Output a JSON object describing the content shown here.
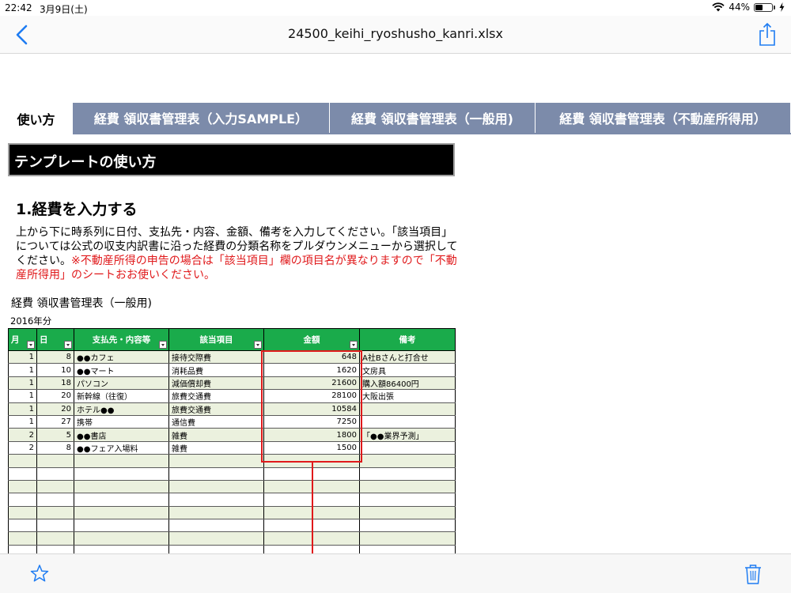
{
  "status": {
    "time": "22:42",
    "date": "3月9日(土)",
    "battery": "44%",
    "battery_level": 0.44
  },
  "nav": {
    "title": "24500_keihi_ryoshusho_kanri.xlsx"
  },
  "tabs": [
    {
      "label": "使い方",
      "active": true
    },
    {
      "label": "経費 領収書管理表（入力SAMPLE）",
      "active": false
    },
    {
      "label": "経費 領収書管理表（一般用)",
      "active": false
    },
    {
      "label": "経費 領収書管理表（不動産所得用）",
      "active": false
    }
  ],
  "content": {
    "banner": "テンプレートの使い方",
    "section_title": "1.経費を入力する",
    "para_black": "上から下に時系列に日付、支払先・内容、金額、備考を入力してください。「該当項目」については公式の収支内訳書に沿った経費の分類名称をプルダウンメニューから選択してください。",
    "para_red": "※不動産所得の申告の場合は「該当項目」欄の項目名が異なりますので「不動産所得用」のシートおお使いください。",
    "sheet_title": "経費 領収書管理表（一般用)",
    "year": "2016年分"
  },
  "table": {
    "headers": [
      "月",
      "日",
      "支払先・内容等",
      "該当項目",
      "金額",
      "備考"
    ],
    "rows": [
      [
        "1",
        "8",
        "●●カフェ",
        "接待交際費",
        "648",
        "A社Bさんと打合せ"
      ],
      [
        "1",
        "10",
        "●●マート",
        "消耗品費",
        "1620",
        "文房具"
      ],
      [
        "1",
        "18",
        "パソコン",
        "減価償却費",
        "21600",
        "購入額86400円"
      ],
      [
        "1",
        "20",
        "新幹線（往復）",
        "旅費交通費",
        "28100",
        "大阪出張"
      ],
      [
        "1",
        "20",
        "ホテル●●",
        "旅費交通費",
        "10584",
        ""
      ],
      [
        "1",
        "27",
        "携帯",
        "通信費",
        "7250",
        ""
      ],
      [
        "2",
        "5",
        "●●書店",
        "雑費",
        "1800",
        "「●●業界予測」"
      ],
      [
        "2",
        "8",
        "●●フェア入場料",
        "雑費",
        "1500",
        ""
      ],
      [
        "",
        "",
        "",
        "",
        "",
        ""
      ],
      [
        "",
        "",
        "",
        "",
        "",
        ""
      ],
      [
        "",
        "",
        "",
        "",
        "",
        ""
      ],
      [
        "",
        "",
        "",
        "",
        "",
        ""
      ],
      [
        "",
        "",
        "",
        "",
        "",
        ""
      ],
      [
        "",
        "",
        "",
        "",
        "",
        ""
      ],
      [
        "",
        "",
        "",
        "",
        "",
        ""
      ],
      [
        "",
        "",
        "",
        "",
        "",
        ""
      ]
    ]
  },
  "icons": {
    "back": "chevron-left-icon",
    "share": "share-icon",
    "star": "star-icon",
    "trash": "trash-icon"
  },
  "colors": {
    "accent": "#1e7cf2",
    "tab_bg": "#7c8baa",
    "header_green": "#1aab4b",
    "row_alt": "#ebf1de",
    "annotation_red": "#e0191b"
  }
}
